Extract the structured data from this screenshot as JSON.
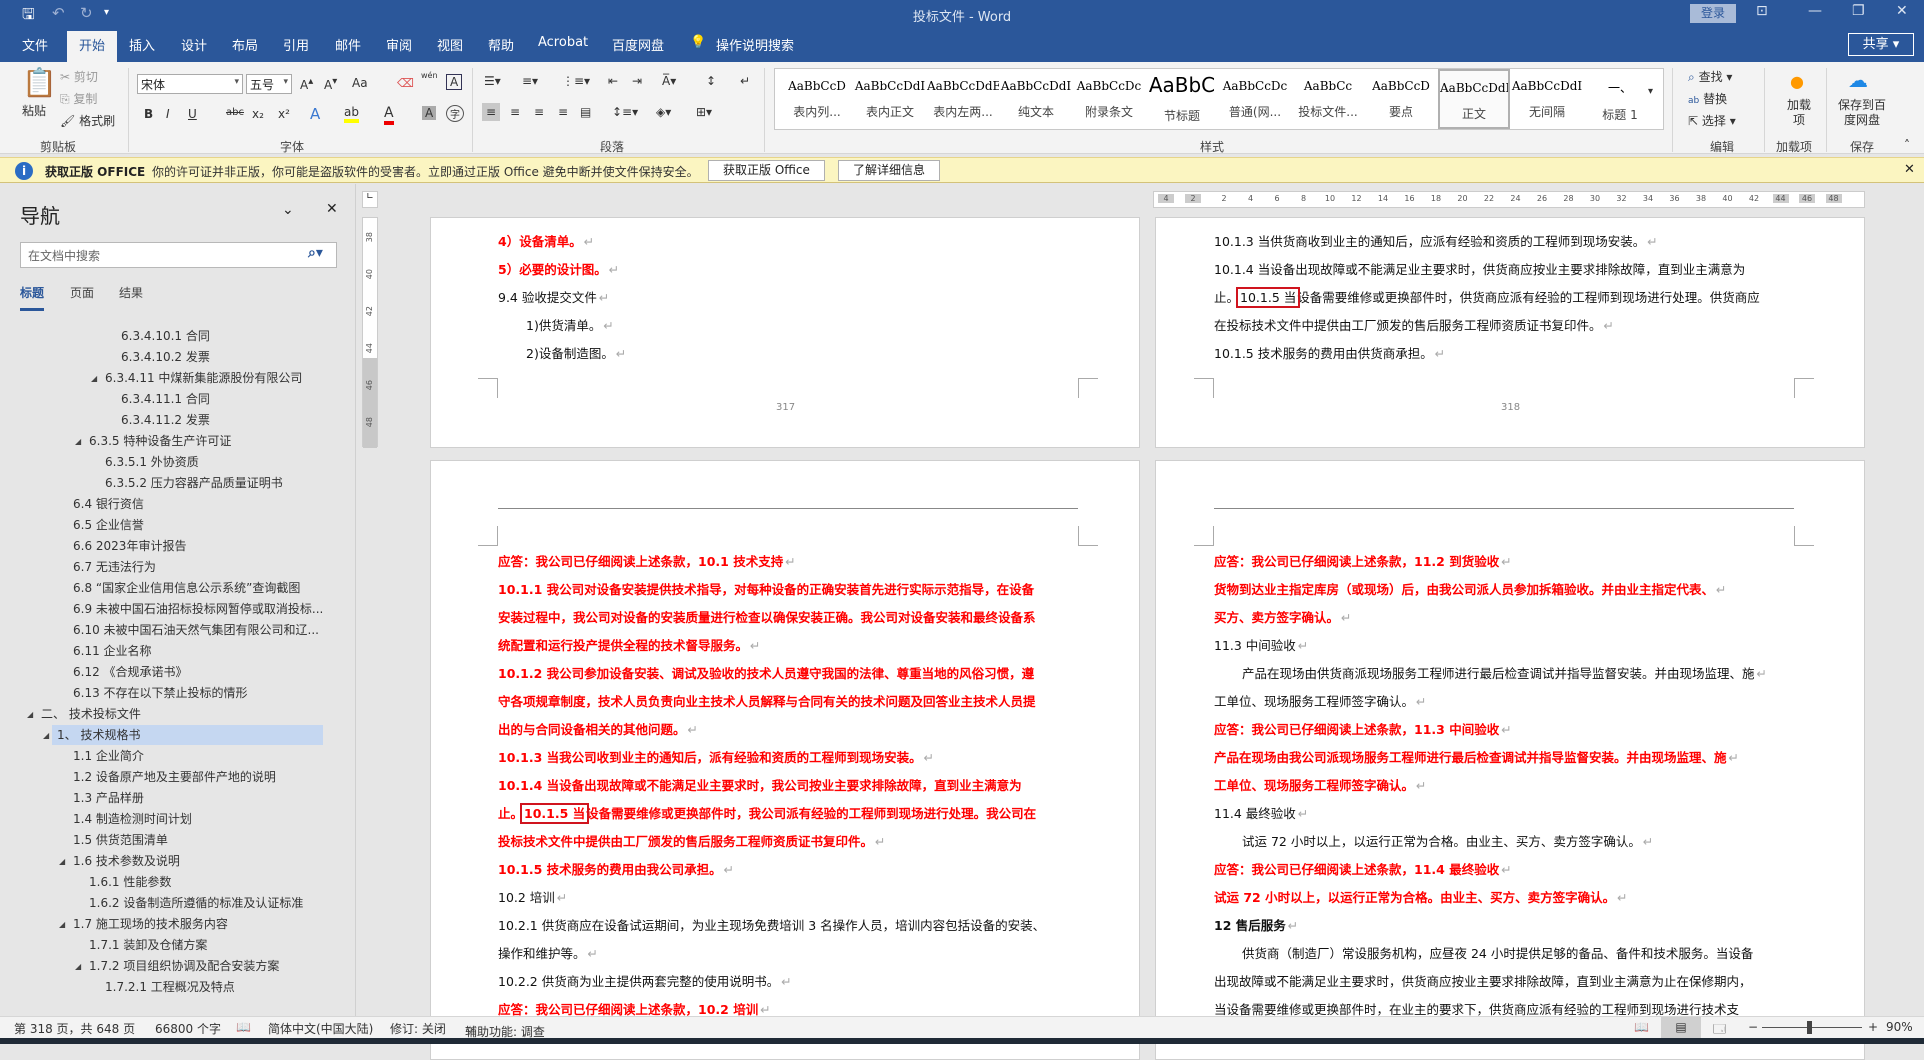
{
  "window": {
    "title": "投标文件 - Word",
    "login": "登录",
    "share": "共享"
  },
  "quick_access": {
    "save": "save-icon",
    "undo": "undo-icon",
    "redo": "redo-icon"
  },
  "tabs": [
    "文件",
    "开始",
    "插入",
    "设计",
    "布局",
    "引用",
    "邮件",
    "审阅",
    "视图",
    "帮助",
    "Acrobat",
    "百度网盘"
  ],
  "active_tab": "开始",
  "tell_me": "操作说明搜索",
  "ribbon": {
    "clipboard": {
      "paste": "粘贴",
      "cut": "剪切",
      "copy": "复制",
      "format_painter": "格式刷",
      "label": "剪贴板"
    },
    "font": {
      "name": "宋体",
      "size": "五号",
      "label": "字体",
      "bold": "B",
      "italic": "I",
      "underline": "U",
      "strike": "abc",
      "sub": "x₂",
      "sup": "x²",
      "grow": "A^",
      "shrink": "Aˇ",
      "case": "Aa",
      "wen": "wén"
    },
    "paragraph": {
      "label": "段落"
    },
    "styles": {
      "label": "样式",
      "items": [
        {
          "sample": "AaBbCcD",
          "name": "表内列..."
        },
        {
          "sample": "AaBbCcDdI",
          "name": "表内正文"
        },
        {
          "sample": "AaBbCcDdEe",
          "name": "表内左两..."
        },
        {
          "sample": "AaBbCcDdI",
          "name": "纯文本"
        },
        {
          "sample": "AaBbCcDc",
          "name": "附录条文"
        },
        {
          "sample": "AaBbC",
          "name": "节标题"
        },
        {
          "sample": "AaBbCcDc",
          "name": "普通(网..."
        },
        {
          "sample": "AaBbCc",
          "name": "投标文件..."
        },
        {
          "sample": "AaBbCcD",
          "name": "要点"
        },
        {
          "sample": "AaBbCcDdI",
          "name": "正文"
        },
        {
          "sample": "AaBbCcDdI",
          "name": "无间隔"
        },
        {
          "sample": "一、",
          "name": "标题 1"
        }
      ],
      "selected": "正文"
    },
    "editing": {
      "find": "查找",
      "replace": "替换",
      "select": "选择",
      "label": "编辑"
    },
    "addins": {
      "button": "加载项",
      "label": "加载项"
    },
    "save": {
      "button": "保存到百度网盘",
      "label": "保存"
    }
  },
  "infobar": {
    "title": "获取正版 OFFICE",
    "message": "你的许可证并非正版，你可能是盗版软件的受害者。立即通过正版 Office 避免中断并使文件保持安全。",
    "btn_get": "获取正版 Office",
    "btn_more": "了解详细信息"
  },
  "nav": {
    "title": "导航",
    "search_placeholder": "在文档中搜索",
    "tabs": [
      "标题",
      "页面",
      "结果"
    ],
    "items": [
      {
        "level": 5,
        "text": "6.3.4.10.1 合同"
      },
      {
        "level": 5,
        "text": "6.3.4.10.2 发票"
      },
      {
        "level": 4,
        "text": "6.3.4.11 中煤新集能源股份有限公司",
        "expanded": true
      },
      {
        "level": 5,
        "text": "6.3.4.11.1 合同"
      },
      {
        "level": 5,
        "text": "6.3.4.11.2 发票"
      },
      {
        "level": 3,
        "text": "6.3.5 特种设备生产许可证",
        "expanded": true
      },
      {
        "level": 4,
        "text": "6.3.5.1 外协资质"
      },
      {
        "level": 4,
        "text": "6.3.5.2 压力容器产品质量证明书"
      },
      {
        "level": 2,
        "text": "6.4 银行资信"
      },
      {
        "level": 2,
        "text": "6.5 企业信誉"
      },
      {
        "level": 2,
        "text": "6.6 2023年审计报告"
      },
      {
        "level": 2,
        "text": "6.7 无违法行为"
      },
      {
        "level": 2,
        "text": "6.8 “国家企业信用信息公示系统”查询截图"
      },
      {
        "level": 2,
        "text": "6.9 未被中国石油招标投标网暂停或取消投标..."
      },
      {
        "level": 2,
        "text": "6.10 未被中国石油天然气集团有限公司和辽..."
      },
      {
        "level": 2,
        "text": "6.11 企业名称"
      },
      {
        "level": 2,
        "text": "6.12 《合规承诺书》"
      },
      {
        "level": 2,
        "text": "6.13 不存在以下禁止投标的情形"
      },
      {
        "level": 0,
        "text": "二、 技术投标文件",
        "expanded": true
      },
      {
        "level": 1,
        "text": "1、 技术规格书",
        "expanded": true,
        "selected": true
      },
      {
        "level": 2,
        "text": "1.1 企业简介"
      },
      {
        "level": 2,
        "text": "1.2 设备原产地及主要部件产地的说明"
      },
      {
        "level": 2,
        "text": "1.3 产品样册"
      },
      {
        "level": 2,
        "text": "1.4 制造检测时间计划"
      },
      {
        "level": 2,
        "text": "1.5 供货范围清单"
      },
      {
        "level": 2,
        "text": "1.6 技术参数及说明",
        "expanded": true
      },
      {
        "level": 3,
        "text": "1.6.1 性能参数"
      },
      {
        "level": 3,
        "text": "1.6.2 设备制造所遵循的标准及认证标准"
      },
      {
        "level": 2,
        "text": "1.7 施工现场的技术服务内容",
        "expanded": true
      },
      {
        "level": 3,
        "text": "1.7.1 装卸及仓储方案"
      },
      {
        "level": 3,
        "text": "1.7.2 项目组织协调及配合安装方案",
        "expanded": true
      },
      {
        "level": 4,
        "text": "1.7.2.1 工程概况及特点"
      }
    ]
  },
  "rulers": {
    "horizontal": [
      "4",
      "2",
      "2",
      "4",
      "6",
      "8",
      "10",
      "12",
      "14",
      "16",
      "18",
      "20",
      "22",
      "24",
      "26",
      "28",
      "30",
      "32",
      "34",
      "36",
      "38",
      "40",
      "42",
      "44",
      "46",
      "48"
    ],
    "vertical": [
      "38",
      "40",
      "42",
      "44",
      "46",
      "48"
    ]
  },
  "pages": [
    {
      "page_number": "317",
      "lines": [
        {
          "style": "red",
          "segs": [
            "4）设备清单。"
          ]
        },
        {
          "style": "red",
          "segs": [
            "5）必要的设计图。"
          ]
        },
        {
          "style": "black",
          "segs": [
            "9.4 验收提交文件"
          ]
        },
        {
          "style": "black sub",
          "segs": [
            "1)供货清单。"
          ]
        },
        {
          "style": "black sub",
          "segs": [
            "2)设备制造图。"
          ]
        }
      ]
    },
    {
      "page_number": "318",
      "lines": [
        {
          "style": "black",
          "segs": [
            "10.1.3 当供货商收到业主的通知后，应派有经验和资质的工程师到现场安装。"
          ]
        },
        {
          "style": "black nopm",
          "segs": [
            "10.1.4 当设备出现故障或不能满足业主要求时，供货商应按业主要求排除故障，直到业主满意为"
          ]
        },
        {
          "style": "black nopm",
          "segs": [
            "止。",
            "10.1.5 当",
            "设备需要维修或更换部件时，供货商应派有经验的工程师到现场进行处理。供货商应"
          ]
        },
        {
          "style": "black",
          "segs": [
            "在投标技术文件中提供由工厂颁发的售后服务工程师资质证书复印件。"
          ]
        },
        {
          "style": "black",
          "segs": [
            "10.1.5 技术服务的费用由供货商承担。"
          ]
        }
      ]
    },
    {
      "lines": [
        {
          "style": "red",
          "segs": [
            "应答：我公司已仔细阅读上述条款，10.1 技术支持"
          ]
        },
        {
          "style": "red nopm",
          "segs": [
            "10.1.1 我公司对设备安装提供技术指导，对每种设备的正确安装首先进行实际示范指导，在设备"
          ]
        },
        {
          "style": "red nopm",
          "segs": [
            "安装过程中，我公司对设备的安装质量进行检查以确保安装正确。我公司对设备安装和最终设备系"
          ]
        },
        {
          "style": "red",
          "segs": [
            "统配置和运行投产提供全程的技术督导服务。"
          ]
        },
        {
          "style": "red nopm",
          "segs": [
            "10.1.2 我公司参加设备安装、调试及验收的技术人员遵守我国的法律、尊重当地的风俗习惯，遵"
          ]
        },
        {
          "style": "red nopm",
          "segs": [
            "守各项规章制度，技术人员负责向业主技术人员解释与合同有关的技术问题及回答业主技术人员提"
          ]
        },
        {
          "style": "red",
          "segs": [
            "出的与合同设备相关的其他问题。"
          ]
        },
        {
          "style": "red",
          "segs": [
            "10.1.3 当我公司收到业主的通知后，派有经验和资质的工程师到现场安装。"
          ]
        },
        {
          "style": "red nopm",
          "segs": [
            "10.1.4 当设备出现故障或不能满足业主要求时，我公司按业主要求排除故障，直到业主满意为"
          ]
        },
        {
          "style": "red nopm",
          "segs": [
            "止。",
            "10.1.5 当",
            "设备需要维修或更换部件时，我公司派有经验的工程师到现场进行处理。我公司在"
          ]
        },
        {
          "style": "red",
          "segs": [
            "投标技术文件中提供由工厂颁发的售后服务工程师资质证书复印件。"
          ]
        },
        {
          "style": "red",
          "segs": [
            "10.1.5 技术服务的费用由我公司承担。"
          ]
        },
        {
          "style": "black",
          "segs": [
            "10.2 培训"
          ]
        },
        {
          "style": "black nopm",
          "segs": [
            "10.2.1 供货商应在设备试运期间，为业主现场免费培训 3 名操作人员，培训内容包括设备的安装、"
          ]
        },
        {
          "style": "black",
          "segs": [
            "操作和维护等。"
          ]
        },
        {
          "style": "black",
          "segs": [
            "10.2.2 供货商为业主提供两套完整的使用说明书。"
          ]
        },
        {
          "style": "red",
          "segs": [
            "应答：我公司已仔细阅读上述条款，10.2 培训"
          ]
        }
      ]
    },
    {
      "lines": [
        {
          "style": "red",
          "segs": [
            "应答：我公司已仔细阅读上述条款，11.2 到货验收"
          ]
        },
        {
          "style": "red",
          "segs": [
            "货物到达业主指定库房（或现场）后，由我公司派人员参加拆箱验收。并由业主指定代表、"
          ]
        },
        {
          "style": "red",
          "segs": [
            "买方、卖方签字确认。"
          ]
        },
        {
          "style": "black",
          "segs": [
            "11.3 中间验收"
          ]
        },
        {
          "style": "black indent",
          "segs": [
            "产品在现场由供货商派现场服务工程师进行最后检查调试并指导监督安装。并由现场监理、施"
          ]
        },
        {
          "style": "black",
          "segs": [
            "工单位、现场服务工程师签字确认。"
          ]
        },
        {
          "style": "red",
          "segs": [
            "应答：我公司已仔细阅读上述条款，11.3 中间验收"
          ]
        },
        {
          "style": "red",
          "segs": [
            "产品在现场由我公司派现场服务工程师进行最后检查调试并指导监督安装。并由现场监理、施"
          ]
        },
        {
          "style": "red",
          "segs": [
            "工单位、现场服务工程师签字确认。"
          ]
        },
        {
          "style": "black",
          "segs": [
            "11.4 最终验收"
          ]
        },
        {
          "style": "black indent",
          "segs": [
            "试运 72 小时以上，以运行正常为合格。由业主、买方、卖方签字确认。"
          ]
        },
        {
          "style": "red",
          "segs": [
            "应答：我公司已仔细阅读上述条款，11.4 最终验收"
          ]
        },
        {
          "style": "red",
          "segs": [
            "试运 72 小时以上，以运行正常为合格。由业主、买方、卖方签字确认。"
          ]
        },
        {
          "style": "boldb",
          "segs": [
            "12 售后服务"
          ]
        },
        {
          "style": "black indent nopm",
          "segs": [
            "供货商（制造厂）常设服务机构，应昼夜 24 小时提供足够的备品、备件和技术服务。当设备"
          ]
        },
        {
          "style": "black nopm",
          "segs": [
            "出现故障或不能满足业主要求时，供货商应按业主要求排除故障，直到业主满意为止在保修期内，"
          ]
        },
        {
          "style": "black nopm",
          "segs": [
            "当设备需要维修或更换部件时，在业主的要求下，供货商应派有经验的工程师到现场进行技术支"
          ]
        }
      ]
    }
  ],
  "status": {
    "page": "第 318 页，共 648 页",
    "words": "66800 个字",
    "language": "简体中文(中国大陆)",
    "track": "修订: 关闭",
    "accessibility": "辅助功能: 调查",
    "zoom": "90%",
    "zoom_fraction": 0.45
  }
}
